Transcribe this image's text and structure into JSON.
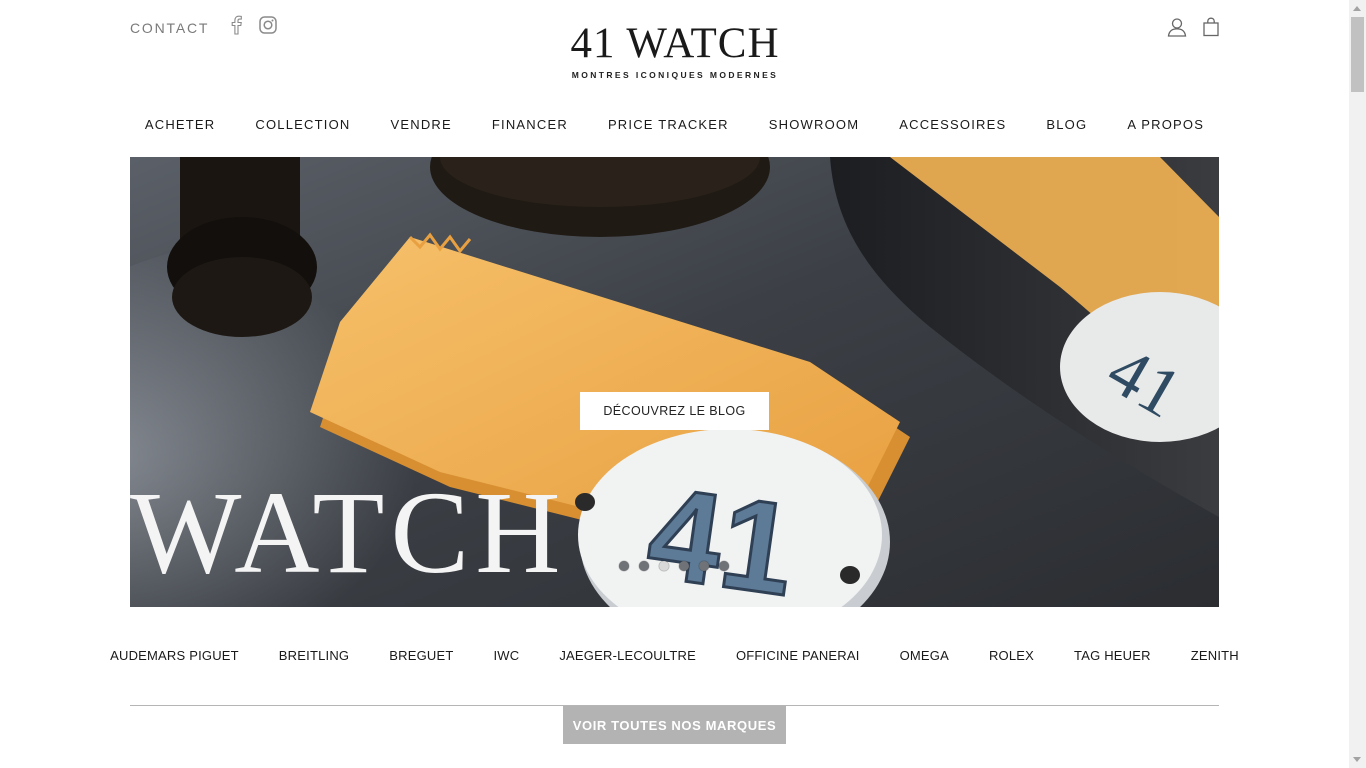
{
  "header": {
    "contact_label": "CONTACT",
    "social_icons": [
      "facebook-icon",
      "instagram-icon"
    ],
    "logo_name": "41 WATCH",
    "logo_tagline": "MONTRES ICONIQUES MODERNES",
    "right_icons": [
      "user-icon",
      "shopping-bag-icon"
    ]
  },
  "nav": {
    "items": [
      {
        "label": "ACHETER"
      },
      {
        "label": "COLLECTION"
      },
      {
        "label": "VENDRE"
      },
      {
        "label": "FINANCER"
      },
      {
        "label": "PRICE TRACKER"
      },
      {
        "label": "SHOWROOM"
      },
      {
        "label": "ACCESSOIRES"
      },
      {
        "label": "BLOG"
      },
      {
        "label": "A PROPOS"
      }
    ]
  },
  "hero": {
    "cta_label": "DÉCOUVREZ LE BLOG",
    "overlay_text": "WATCH",
    "plate_number": "41",
    "slide_count": 6,
    "active_slide": 3
  },
  "brands": {
    "items": [
      {
        "label": "AUDEMARS PIGUET"
      },
      {
        "label": "BREITLING"
      },
      {
        "label": "BREGUET"
      },
      {
        "label": "IWC"
      },
      {
        "label": "JAEGER-LECOULTRE"
      },
      {
        "label": "OFFICINE PANERAI"
      },
      {
        "label": "OMEGA"
      },
      {
        "label": "ROLEX"
      },
      {
        "label": "TAG HEUER"
      },
      {
        "label": "ZENITH"
      }
    ],
    "all_brands_label": "VOIR TOUTES NOS MARQUES"
  },
  "colors": {
    "text": "#1a1a1a",
    "muted": "#7a7a7a",
    "cloth": "#f0b152",
    "hero_bg": "#3a3d42",
    "button_grey": "#b3b3b3"
  }
}
